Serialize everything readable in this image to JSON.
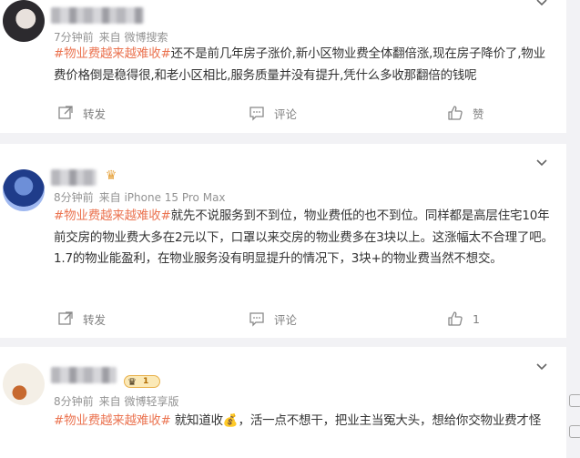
{
  "posts": [
    {
      "time": "7分钟前",
      "source": "来自 微博搜索",
      "tag": "#物业费越来越难收#",
      "text": "还不是前几年房子涨价,新小区物业费全体翻倍涨,现在房子降价了,物业费价格倒是稳得很,和老小区相比,服务质量并没有提升,凭什么多收那翻倍的钱呢",
      "repost_label": "转发",
      "comment_label": "评论",
      "like_label": "赞"
    },
    {
      "time": "8分钟前",
      "source": "来自 iPhone 15 Pro Max",
      "tag": "#物业费越来越难收#",
      "text": "就先不说服务到不到位，物业费低的也不到位。同样都是高层住宅10年前交房的物业费大多在2元以下，口罩以来交房的物业费多在3块以上。这涨幅太不合理了吧。1.7的物业能盈利，在物业服务没有明显提升的情况下，3块+的物业费当然不想交。",
      "repost_label": "转发",
      "comment_label": "评论",
      "like_label": "1"
    },
    {
      "time": "8分钟前",
      "source": "来自 微博轻享版",
      "tag": "#物业费越来越难收#",
      "text_before_emoji": " 就知道收",
      "text_after_emoji": "，活一点不想干，把业主当冤大头，想给你交物业费才怪",
      "emoji": "💰",
      "vip_level": "1"
    }
  ],
  "colors": {
    "tag": "#eb7350",
    "meta": "#939393",
    "action": "#808080",
    "background": "#f2f2f5"
  },
  "icons": [
    "chevron-down-icon",
    "repost-icon",
    "comment-icon",
    "like-icon",
    "crown-icon"
  ]
}
